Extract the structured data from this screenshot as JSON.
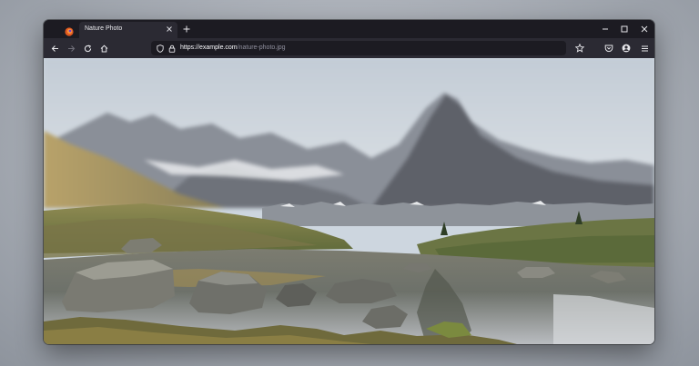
{
  "browser": {
    "tab": {
      "title": "Nature Photo"
    },
    "address_bar": {
      "host": "https://example.com",
      "path": "/nature-photo.jpg"
    }
  },
  "icons": {
    "app": "firefox-icon",
    "tab_close": "close-icon",
    "new_tab": "plus-icon",
    "minimize": "minimize-icon",
    "maximize": "maximize-icon",
    "window_close": "close-icon",
    "back": "back-arrow-icon",
    "forward": "forward-arrow-icon",
    "reload": "reload-icon",
    "home": "home-icon",
    "tracking": "shield-icon",
    "security": "lock-icon",
    "bookmark": "star-icon",
    "pocket": "pocket-icon",
    "account": "account-icon",
    "menu": "hamburger-menu-icon"
  },
  "colors": {
    "frame": "#1c1b22",
    "toolbar": "#2b2a33",
    "text": "#fbfbfe"
  }
}
